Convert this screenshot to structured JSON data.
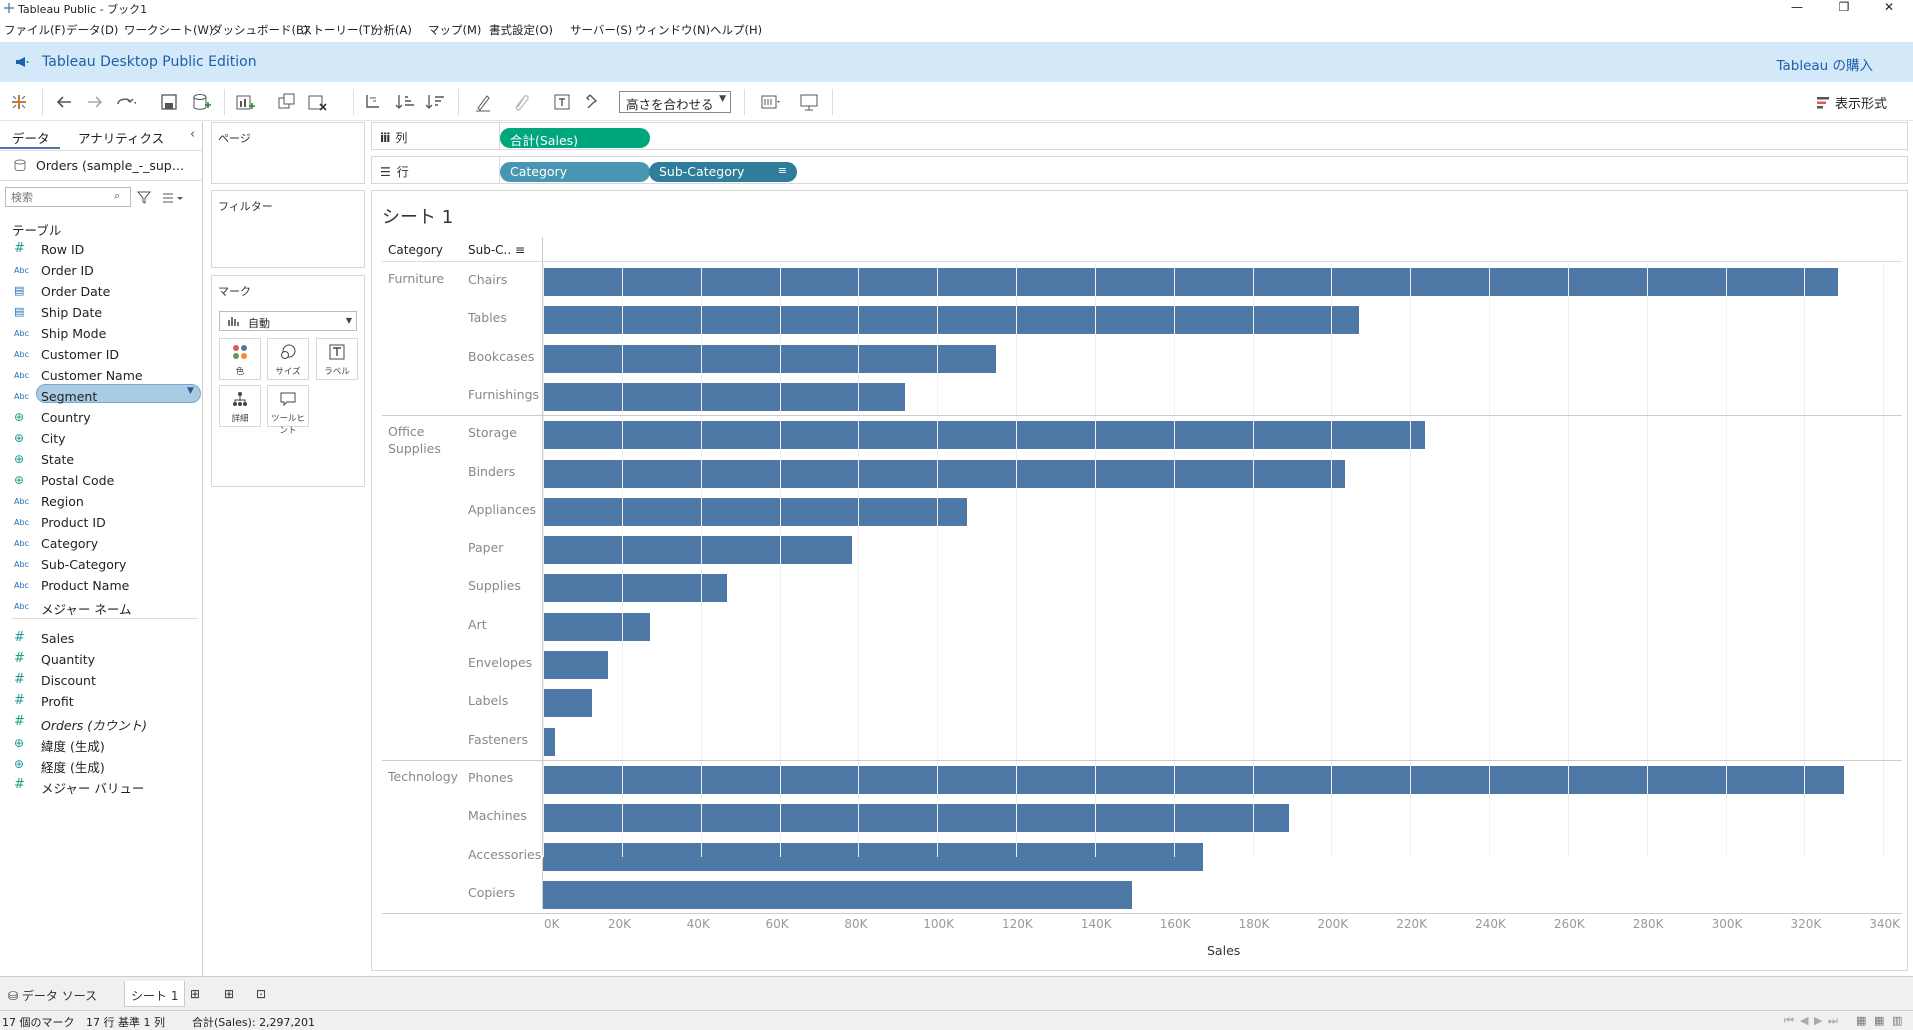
{
  "window": {
    "title": "Tableau Public - ブック1",
    "minimize": "—",
    "restore": "❐",
    "close": "✕"
  },
  "menu": [
    "ファイル(F)",
    "データ(D)",
    "ワークシート(W)",
    "ダッシュボード(B)",
    "ストーリー(T)",
    "分析(A)",
    "マップ(M)",
    "書式設定(O)",
    "サーバー(S)",
    "ウィンドウ(N)",
    "ヘルプ(H)"
  ],
  "banner": {
    "product": "Tableau Desktop Public Edition",
    "buy": "Tableau の購入"
  },
  "toolbar": {
    "fit": "高さを合わせる",
    "show_me": "表示形式"
  },
  "datapane": {
    "tab_data": "データ",
    "tab_analytics": "アナリティクス",
    "datasource": "Orders (sample_-_sup…",
    "search_placeholder": "検索",
    "tables_label": "テーブル",
    "dimensions": [
      {
        "icon": "#",
        "name": "Row ID"
      },
      {
        "icon": "Abc",
        "name": "Order ID"
      },
      {
        "icon": "cal",
        "name": "Order Date"
      },
      {
        "icon": "cal",
        "name": "Ship Date"
      },
      {
        "icon": "Abc",
        "name": "Ship Mode"
      },
      {
        "icon": "Abc",
        "name": "Customer ID"
      },
      {
        "icon": "Abc",
        "name": "Customer Name"
      },
      {
        "icon": "Abc",
        "name": "Segment"
      },
      {
        "icon": "globe",
        "name": "Country"
      },
      {
        "icon": "globe",
        "name": "City"
      },
      {
        "icon": "globe",
        "name": "State"
      },
      {
        "icon": "globe",
        "name": "Postal Code"
      },
      {
        "icon": "Abc",
        "name": "Region"
      },
      {
        "icon": "Abc",
        "name": "Product ID"
      },
      {
        "icon": "Abc",
        "name": "Category"
      },
      {
        "icon": "Abc",
        "name": "Sub-Category"
      },
      {
        "icon": "Abc",
        "name": "Product Name"
      },
      {
        "icon": "Abc",
        "name": "メジャー ネーム"
      }
    ],
    "measures": [
      {
        "icon": "#",
        "name": "Sales"
      },
      {
        "icon": "#",
        "name": "Quantity"
      },
      {
        "icon": "#",
        "name": "Discount"
      },
      {
        "icon": "#",
        "name": "Profit"
      },
      {
        "icon": "#",
        "name": "Orders (カウント)"
      },
      {
        "icon": "globe",
        "name": "緯度 (生成)"
      },
      {
        "icon": "globe",
        "name": "経度 (生成)"
      },
      {
        "icon": "#",
        "name": "メジャー バリュー"
      }
    ]
  },
  "cards": {
    "pages": "ページ",
    "filters": "フィルター",
    "marks": "マーク",
    "mark_type": "自動",
    "mark_buttons": [
      "色",
      "サイズ",
      "ラベル",
      "詳細",
      "ツールヒント"
    ]
  },
  "shelves": {
    "columns_label": "列",
    "rows_label": "行",
    "columns_pill": "合計(Sales)",
    "rows_pills": [
      "Category",
      "Sub-Category"
    ]
  },
  "sheet": {
    "title": "シート 1",
    "col_header_1": "Category",
    "col_header_2": "Sub-C..",
    "x_axis_label": "Sales"
  },
  "chart_data": {
    "type": "bar",
    "orientation": "horizontal",
    "xlabel": "Sales",
    "xlim": [
      0,
      345000
    ],
    "x_ticks": [
      "0K",
      "20K",
      "40K",
      "60K",
      "80K",
      "100K",
      "120K",
      "140K",
      "160K",
      "180K",
      "200K",
      "220K",
      "240K",
      "260K",
      "280K",
      "300K",
      "320K",
      "340K"
    ],
    "groups": [
      {
        "category": "Furniture",
        "items": [
          {
            "sub": "Chairs",
            "value": 328449
          },
          {
            "sub": "Tables",
            "value": 206966
          },
          {
            "sub": "Bookcases",
            "value": 114880
          },
          {
            "sub": "Furnishings",
            "value": 91705
          }
        ]
      },
      {
        "category": "Office\nSupplies",
        "items": [
          {
            "sub": "Storage",
            "value": 223844
          },
          {
            "sub": "Binders",
            "value": 203413
          },
          {
            "sub": "Appliances",
            "value": 107532
          },
          {
            "sub": "Paper",
            "value": 78479
          },
          {
            "sub": "Supplies",
            "value": 46674
          },
          {
            "sub": "Art",
            "value": 27119
          },
          {
            "sub": "Envelopes",
            "value": 16476
          },
          {
            "sub": "Labels",
            "value": 12486
          },
          {
            "sub": "Fasteners",
            "value": 3024
          }
        ]
      },
      {
        "category": "Technology",
        "items": [
          {
            "sub": "Phones",
            "value": 330007
          },
          {
            "sub": "Machines",
            "value": 189239
          },
          {
            "sub": "Accessories",
            "value": 167380
          },
          {
            "sub": "Copiers",
            "value": 149528
          }
        ]
      }
    ]
  },
  "tabs": {
    "datasource": "データ ソース",
    "sheet": "シート 1"
  },
  "status": {
    "marks": "17 個のマーク",
    "rows": "17 行 基準 1 列",
    "sum": "合計(Sales): 2,297,201"
  },
  "colors": {
    "bar": "#4e79a7",
    "green_pill": "#00a77d",
    "blue_pill": "#4996b2",
    "banner": "#d3e9fa"
  }
}
